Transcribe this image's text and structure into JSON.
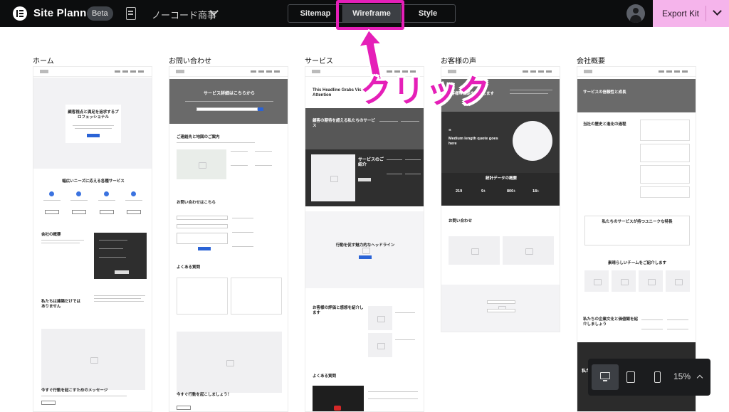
{
  "app": {
    "title": "Site Planner",
    "badge": "Beta"
  },
  "site": {
    "name": "ノーコード商事"
  },
  "tabs": [
    {
      "label": "Sitemap",
      "active": false
    },
    {
      "label": "Wireframe",
      "active": true
    },
    {
      "label": "Style",
      "active": false
    }
  ],
  "export": {
    "label": "Export Kit"
  },
  "annotation": {
    "text": "クリック",
    "color": "#e51fb8"
  },
  "zoom": {
    "value": "15%",
    "active_device": "desktop"
  },
  "icons": [
    "elementor-logo-icon",
    "document-edit-icon",
    "chevron-down-icon",
    "user-avatar-icon",
    "desktop-icon",
    "tablet-icon",
    "mobile-icon",
    "chevron-up-icon",
    "image-placeholder-icon"
  ],
  "pages": [
    {
      "title": "ホーム",
      "hero": "顧客視点と満足を追求するプロフェッショナル",
      "services_heading": "幅広いニーズに応える各種サービス",
      "company_heading": "会社の概要",
      "feature_heading": "私たちは建築だけではありません",
      "cta_heading": "今すぐ行動を起こすためのメッセージ"
    },
    {
      "title": "お問い合わせ",
      "hero": "サービス詳細はこちらから",
      "location_heading": "ご連絡先と地図のご案内",
      "form_heading": "お問い合わせはこちら",
      "faq_heading": "よくある質問",
      "cta_heading": "今すぐ行動を起こしましょう！"
    },
    {
      "title": "サービス",
      "hero": "This Headline Grabs Visitors' Attention",
      "section_heading": "顧客の期待を超える私たちのサービス",
      "detail_heading": "サービスのご紹介",
      "cta_heading": "行動を促す魅力的なヘッドライン",
      "review_heading": "お客様の評価と感想を紹介します",
      "faq_heading": "よくある質問"
    },
    {
      "title": "お客様の声",
      "hero": "お客様の満足を紹介します",
      "quote": "Medium length quote goes here",
      "stats_heading": "統計データの概要",
      "stats": [
        "219",
        "9+",
        "800+",
        "18+"
      ],
      "contact_heading": "お問い合わせ"
    },
    {
      "title": "会社概要",
      "hero": "サービスの信頼性と成長",
      "history_heading": "当社の歴史と進化の過程",
      "feature_heading": "私たちのサービスが持つユニークな特長",
      "team_heading": "素晴らしいチームをご紹介します",
      "philosophy_heading": "私たちの企業文化と価値観を紹介しましょう",
      "footer_label": "私た"
    }
  ]
}
